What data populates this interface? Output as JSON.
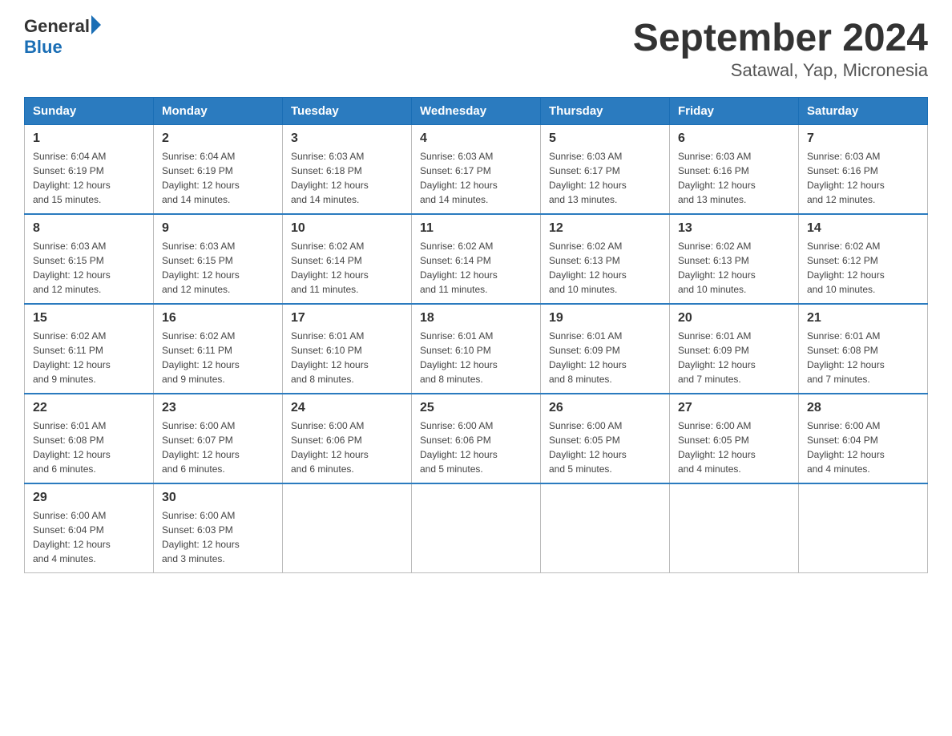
{
  "header": {
    "logo_general": "General",
    "logo_blue": "Blue",
    "month_year": "September 2024",
    "location": "Satawal, Yap, Micronesia"
  },
  "days_of_week": [
    "Sunday",
    "Monday",
    "Tuesday",
    "Wednesday",
    "Thursday",
    "Friday",
    "Saturday"
  ],
  "weeks": [
    [
      {
        "day": "1",
        "sunrise": "6:04 AM",
        "sunset": "6:19 PM",
        "daylight": "12 hours and 15 minutes."
      },
      {
        "day": "2",
        "sunrise": "6:04 AM",
        "sunset": "6:19 PM",
        "daylight": "12 hours and 14 minutes."
      },
      {
        "day": "3",
        "sunrise": "6:03 AM",
        "sunset": "6:18 PM",
        "daylight": "12 hours and 14 minutes."
      },
      {
        "day": "4",
        "sunrise": "6:03 AM",
        "sunset": "6:17 PM",
        "daylight": "12 hours and 14 minutes."
      },
      {
        "day": "5",
        "sunrise": "6:03 AM",
        "sunset": "6:17 PM",
        "daylight": "12 hours and 13 minutes."
      },
      {
        "day": "6",
        "sunrise": "6:03 AM",
        "sunset": "6:16 PM",
        "daylight": "12 hours and 13 minutes."
      },
      {
        "day": "7",
        "sunrise": "6:03 AM",
        "sunset": "6:16 PM",
        "daylight": "12 hours and 12 minutes."
      }
    ],
    [
      {
        "day": "8",
        "sunrise": "6:03 AM",
        "sunset": "6:15 PM",
        "daylight": "12 hours and 12 minutes."
      },
      {
        "day": "9",
        "sunrise": "6:03 AM",
        "sunset": "6:15 PM",
        "daylight": "12 hours and 12 minutes."
      },
      {
        "day": "10",
        "sunrise": "6:02 AM",
        "sunset": "6:14 PM",
        "daylight": "12 hours and 11 minutes."
      },
      {
        "day": "11",
        "sunrise": "6:02 AM",
        "sunset": "6:14 PM",
        "daylight": "12 hours and 11 minutes."
      },
      {
        "day": "12",
        "sunrise": "6:02 AM",
        "sunset": "6:13 PM",
        "daylight": "12 hours and 10 minutes."
      },
      {
        "day": "13",
        "sunrise": "6:02 AM",
        "sunset": "6:13 PM",
        "daylight": "12 hours and 10 minutes."
      },
      {
        "day": "14",
        "sunrise": "6:02 AM",
        "sunset": "6:12 PM",
        "daylight": "12 hours and 10 minutes."
      }
    ],
    [
      {
        "day": "15",
        "sunrise": "6:02 AM",
        "sunset": "6:11 PM",
        "daylight": "12 hours and 9 minutes."
      },
      {
        "day": "16",
        "sunrise": "6:02 AM",
        "sunset": "6:11 PM",
        "daylight": "12 hours and 9 minutes."
      },
      {
        "day": "17",
        "sunrise": "6:01 AM",
        "sunset": "6:10 PM",
        "daylight": "12 hours and 8 minutes."
      },
      {
        "day": "18",
        "sunrise": "6:01 AM",
        "sunset": "6:10 PM",
        "daylight": "12 hours and 8 minutes."
      },
      {
        "day": "19",
        "sunrise": "6:01 AM",
        "sunset": "6:09 PM",
        "daylight": "12 hours and 8 minutes."
      },
      {
        "day": "20",
        "sunrise": "6:01 AM",
        "sunset": "6:09 PM",
        "daylight": "12 hours and 7 minutes."
      },
      {
        "day": "21",
        "sunrise": "6:01 AM",
        "sunset": "6:08 PM",
        "daylight": "12 hours and 7 minutes."
      }
    ],
    [
      {
        "day": "22",
        "sunrise": "6:01 AM",
        "sunset": "6:08 PM",
        "daylight": "12 hours and 6 minutes."
      },
      {
        "day": "23",
        "sunrise": "6:00 AM",
        "sunset": "6:07 PM",
        "daylight": "12 hours and 6 minutes."
      },
      {
        "day": "24",
        "sunrise": "6:00 AM",
        "sunset": "6:06 PM",
        "daylight": "12 hours and 6 minutes."
      },
      {
        "day": "25",
        "sunrise": "6:00 AM",
        "sunset": "6:06 PM",
        "daylight": "12 hours and 5 minutes."
      },
      {
        "day": "26",
        "sunrise": "6:00 AM",
        "sunset": "6:05 PM",
        "daylight": "12 hours and 5 minutes."
      },
      {
        "day": "27",
        "sunrise": "6:00 AM",
        "sunset": "6:05 PM",
        "daylight": "12 hours and 4 minutes."
      },
      {
        "day": "28",
        "sunrise": "6:00 AM",
        "sunset": "6:04 PM",
        "daylight": "12 hours and 4 minutes."
      }
    ],
    [
      {
        "day": "29",
        "sunrise": "6:00 AM",
        "sunset": "6:04 PM",
        "daylight": "12 hours and 4 minutes."
      },
      {
        "day": "30",
        "sunrise": "6:00 AM",
        "sunset": "6:03 PM",
        "daylight": "12 hours and 3 minutes."
      },
      null,
      null,
      null,
      null,
      null
    ]
  ],
  "labels": {
    "sunrise": "Sunrise:",
    "sunset": "Sunset:",
    "daylight": "Daylight:"
  }
}
